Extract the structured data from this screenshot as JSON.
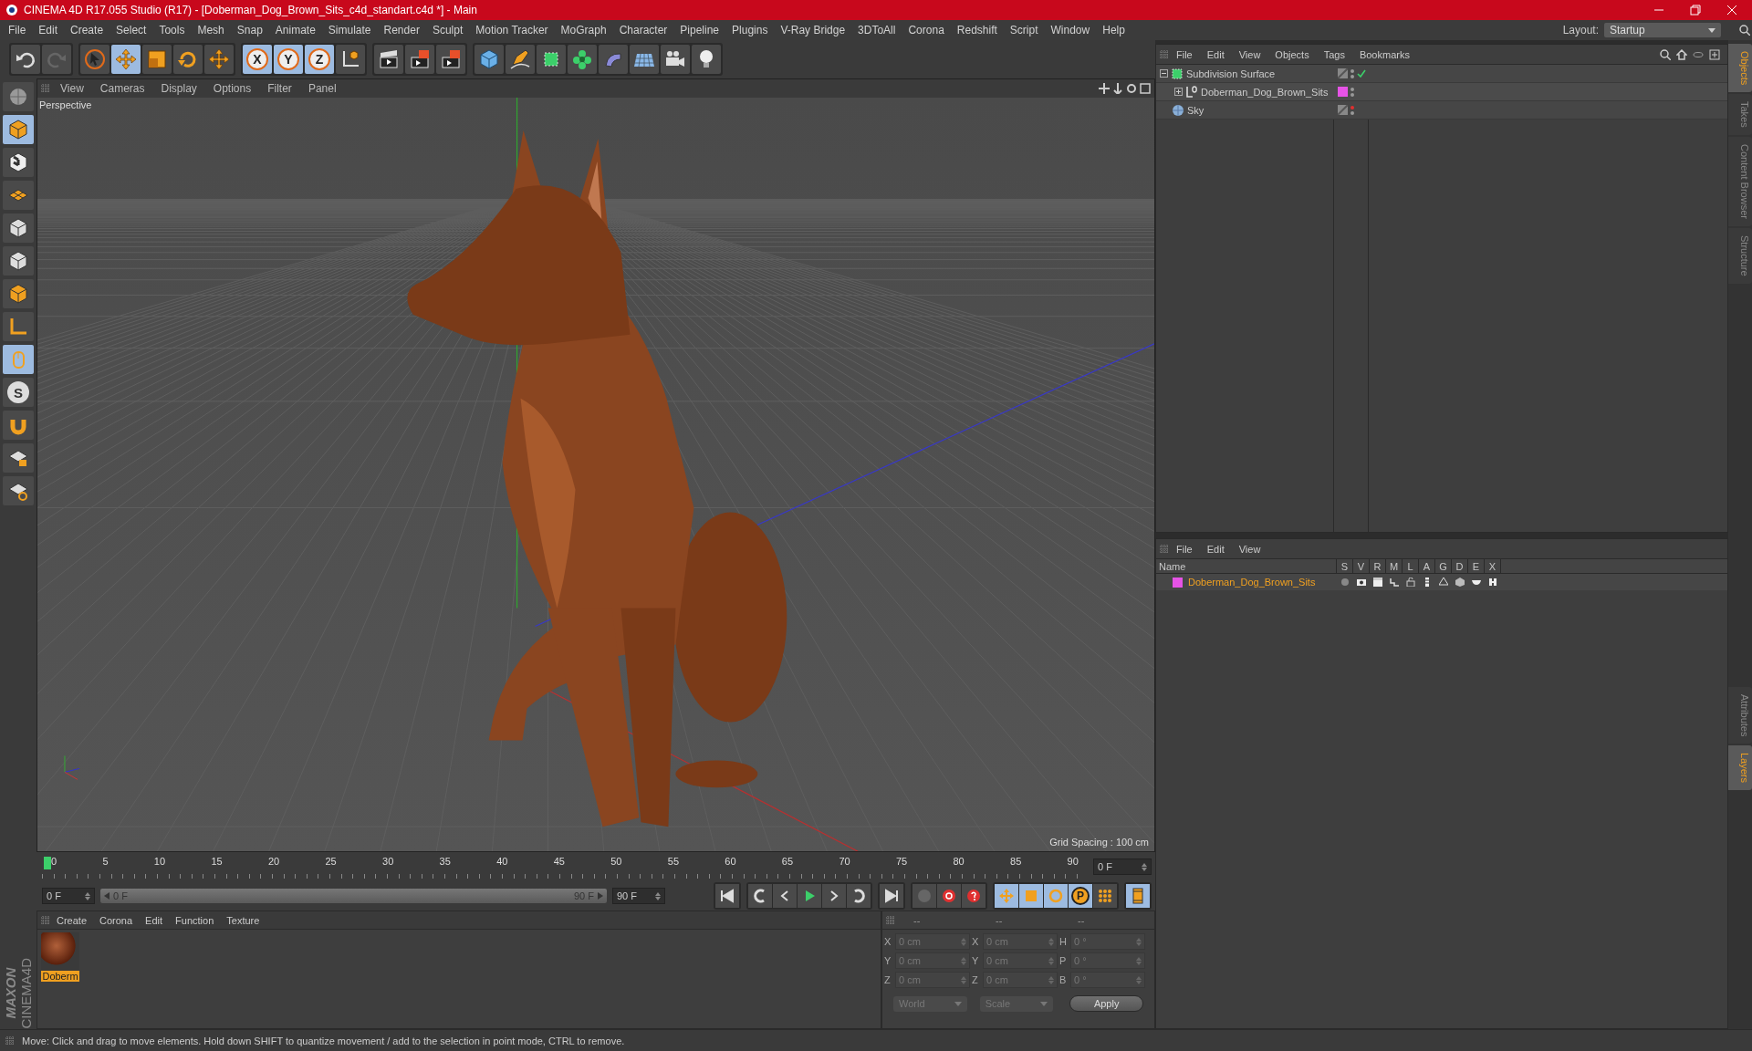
{
  "window": {
    "title": "CINEMA 4D R17.055 Studio (R17) - [Doberman_Dog_Brown_Sits_c4d_standart.c4d *] - Main"
  },
  "menu_bar": [
    "File",
    "Edit",
    "Create",
    "Select",
    "Tools",
    "Mesh",
    "Snap",
    "Animate",
    "Simulate",
    "Render",
    "Sculpt",
    "Motion Tracker",
    "MoGraph",
    "Character",
    "Pipeline",
    "Plugins",
    "V-Ray Bridge",
    "3DToAll",
    "Corona",
    "Redshift",
    "Script",
    "Window",
    "Help"
  ],
  "layout": {
    "label": "Layout:",
    "value": "Startup"
  },
  "toolbar": {
    "axis_locks": [
      {
        "label": "X",
        "active": true
      },
      {
        "label": "Y",
        "active": true
      },
      {
        "label": "Z",
        "active": true
      }
    ]
  },
  "left_toolbar": {
    "snap_label": "S"
  },
  "viewport": {
    "menu": [
      "View",
      "Cameras",
      "Display",
      "Options",
      "Filter",
      "Panel"
    ],
    "camera": "Perspective",
    "grid_spacing": "Grid Spacing : 100 cm"
  },
  "timeline": {
    "ticks": [
      "0",
      "5",
      "10",
      "15",
      "20",
      "25",
      "30",
      "35",
      "40",
      "45",
      "50",
      "55",
      "60",
      "65",
      "70",
      "75",
      "80",
      "85",
      "90"
    ],
    "current_frame": "0 F"
  },
  "transport": {
    "start_frame": "0 F",
    "range_start": "0 F",
    "range_end": "90 F",
    "level": 1,
    "end_frame": "90 F",
    "point_key_label": "P"
  },
  "material_manager": {
    "menu": [
      "Create",
      "Corona",
      "Edit",
      "Function",
      "Texture"
    ],
    "materials": [
      {
        "name": "Doberm",
        "selected": true
      }
    ]
  },
  "coordinates": {
    "headers": [
      "--",
      "--",
      "--"
    ],
    "rows": [
      {
        "position_axis": "X",
        "position": "0 cm",
        "size_axis": "X",
        "size": "0 cm",
        "rotation_axis": "H",
        "rotation": "0 °"
      },
      {
        "position_axis": "Y",
        "position": "0 cm",
        "size_axis": "Y",
        "size": "0 cm",
        "rotation_axis": "P",
        "rotation": "0 °"
      },
      {
        "position_axis": "Z",
        "position": "0 cm",
        "size_axis": "Z",
        "size": "0 cm",
        "rotation_axis": "B",
        "rotation": "0 °"
      }
    ],
    "coordinate_system": "World",
    "size_mode": "Scale",
    "apply": "Apply"
  },
  "object_manager": {
    "menu": [
      "File",
      "Edit",
      "View",
      "Objects",
      "Tags",
      "Bookmarks"
    ],
    "objects": [
      {
        "name": "Subdivision Surface",
        "kind": "subdivision",
        "expanded": true,
        "enabled": true,
        "editor_visible": true,
        "children": [
          {
            "name": "Doberman_Dog_Brown_Sits",
            "kind": "null",
            "expanded": false,
            "editor_visible": true,
            "color": "#e653e6"
          }
        ]
      },
      {
        "name": "Sky",
        "kind": "sky",
        "editor_visible": false
      }
    ]
  },
  "layer_manager": {
    "menu": [
      "File",
      "Edit",
      "View"
    ],
    "columns": [
      "Name",
      "S",
      "V",
      "R",
      "M",
      "L",
      "A",
      "G",
      "D",
      "E",
      "X"
    ],
    "layers": [
      {
        "name": "Doberman_Dog_Brown_Sits",
        "color": "#e653e6"
      }
    ]
  },
  "side_tabs": {
    "top": [
      {
        "label": "Objects",
        "selected": true
      },
      {
        "label": "Takes",
        "selected": false
      },
      {
        "label": "Content Browser",
        "selected": false
      },
      {
        "label": "Structure",
        "selected": false
      }
    ],
    "bottom": [
      {
        "label": "Attributes",
        "selected": false
      },
      {
        "label": "Layers",
        "selected": true
      }
    ]
  },
  "logo": {
    "brand": "MAXON",
    "product": "CINEMA4D"
  },
  "status_bar": {
    "text": "Move: Click and drag to move elements. Hold down SHIFT to quantize movement / add to the selection in point mode, CTRL to remove."
  }
}
